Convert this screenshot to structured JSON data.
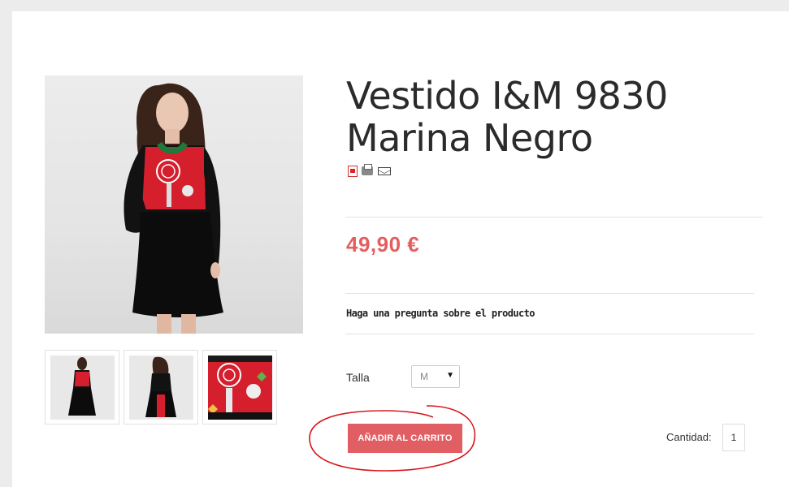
{
  "product": {
    "title_line1": "Vestido I&M 9830",
    "title_line2": "Marina Negro",
    "price": "49,90 €",
    "ask_question": "Haga una pregunta sobre el producto"
  },
  "actions": {
    "icons": [
      "pdf-icon",
      "print-icon",
      "email-icon"
    ]
  },
  "options": {
    "size_label": "Talla",
    "size_selected": "M"
  },
  "cart": {
    "add_button_label": "AÑADIR AL CARRITO",
    "quantity_label": "Cantidad:",
    "quantity_value": "1"
  },
  "colors": {
    "accent": "#e15f63",
    "annotation": "#d8141c"
  }
}
